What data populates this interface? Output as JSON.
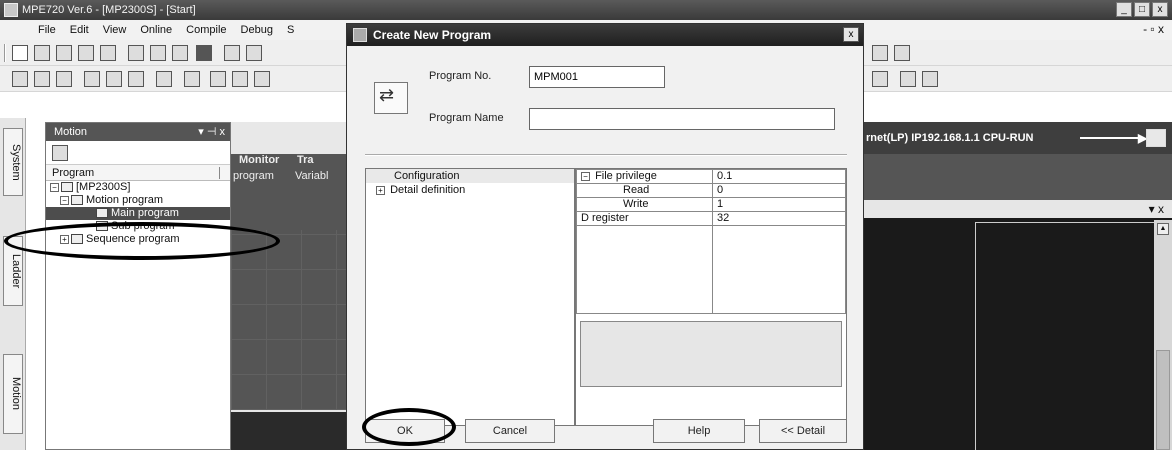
{
  "app": {
    "title": "MPE720 Ver.6 - [MP2300S] - [Start]",
    "window_controls": [
      "_",
      "□",
      "x"
    ],
    "mdi_controls": "- ▫ x"
  },
  "menu": {
    "items": [
      "File",
      "Edit",
      "View",
      "Online",
      "Compile",
      "Debug",
      "S"
    ]
  },
  "side_tabs": {
    "system": "System",
    "ladder": "Ladder",
    "motion": "Motion"
  },
  "motion_panel": {
    "title": "Motion",
    "pin": "▾ ⊣ x",
    "column_header": "Program",
    "tree": [
      {
        "label": "[MP2300S]",
        "level": 0
      },
      {
        "label": "Motion program",
        "level": 1
      },
      {
        "label": "Main program",
        "level": 2
      },
      {
        "label": "Sub program",
        "level": 2
      },
      {
        "label": "Sequence program",
        "level": 1
      }
    ]
  },
  "center": {
    "tab_monitor": "Monitor",
    "tab_tra": "Tra",
    "sub_program": "program",
    "sub_variable": "Variabl"
  },
  "status": {
    "connection": "rnet(LP) IP192.168.1.1 CPU-RUN"
  },
  "right_panel": {
    "close": "▾ x"
  },
  "dialog": {
    "title": "Create New Program",
    "close": "x",
    "program_no_label": "Program No.",
    "program_no_value": "MPM001",
    "program_name_label": "Program Name",
    "program_name_value": "",
    "left_items": {
      "configuration": "Configuration",
      "detail": "Detail definition"
    },
    "properties": [
      {
        "key": "File privilege",
        "value": "0.1",
        "expander": "⊟",
        "indent": false
      },
      {
        "key": "Read",
        "value": "0",
        "indent": true
      },
      {
        "key": "Write",
        "value": "1",
        "indent": true
      },
      {
        "key": "D register",
        "value": "32",
        "indent": false
      }
    ],
    "buttons": {
      "ok": "OK",
      "cancel": "Cancel",
      "help": "Help",
      "detail": "<< Detail"
    }
  }
}
